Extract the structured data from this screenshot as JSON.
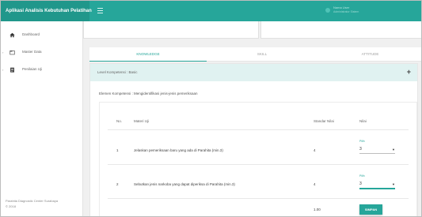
{
  "header": {
    "app_title": "Aplikasi Analisis Kebutuhan Pelatihan",
    "user_name": "Nama User",
    "user_role": "Administrator Sistem"
  },
  "sidebar": {
    "items": [
      {
        "label": "Dashboard",
        "icon": "home-icon"
      },
      {
        "label": "Master Data",
        "icon": "folder-icon"
      },
      {
        "label": "Penilaian Uji",
        "icon": "clipboard-icon"
      }
    ],
    "footer_line1": "Parahita Diagnostic Center Surabaya",
    "footer_line2": "© 2018"
  },
  "tabs": [
    {
      "label": "KNOWLEDGE",
      "active": true
    },
    {
      "label": "SKILL",
      "active": false
    },
    {
      "label": "ATTITUDE",
      "active": false
    }
  ],
  "panel": {
    "title": "Level Kompetensi : Basic",
    "expand_symbol": "+",
    "elemen_text": "Elemen Kompetensi : Mengidentifikasi jenis-jenis pemeriksaan"
  },
  "table": {
    "headers": {
      "no": "No.",
      "materi": "Materi Uji",
      "standar": "Standar Nilai",
      "nilai": "Nilai"
    },
    "rows": [
      {
        "no": "1",
        "materi": "Jelaskan pemeriksaan baru yang ada di Parahita (min.3)",
        "standar": "4",
        "pilih_label": "Pilih",
        "nilai": "3"
      },
      {
        "no": "2",
        "materi": "Sebutkan jenis narkoba yang dapat diperiksa di Parahita (min.3)",
        "standar": "4",
        "pilih_label": "Pilih",
        "nilai": "3"
      }
    ],
    "total": "1.00",
    "save_label": "SIMPAN"
  },
  "colors": {
    "accent": "#26a69a",
    "accent_dark": "#20978b",
    "panel_head": "#e0f2f1"
  }
}
